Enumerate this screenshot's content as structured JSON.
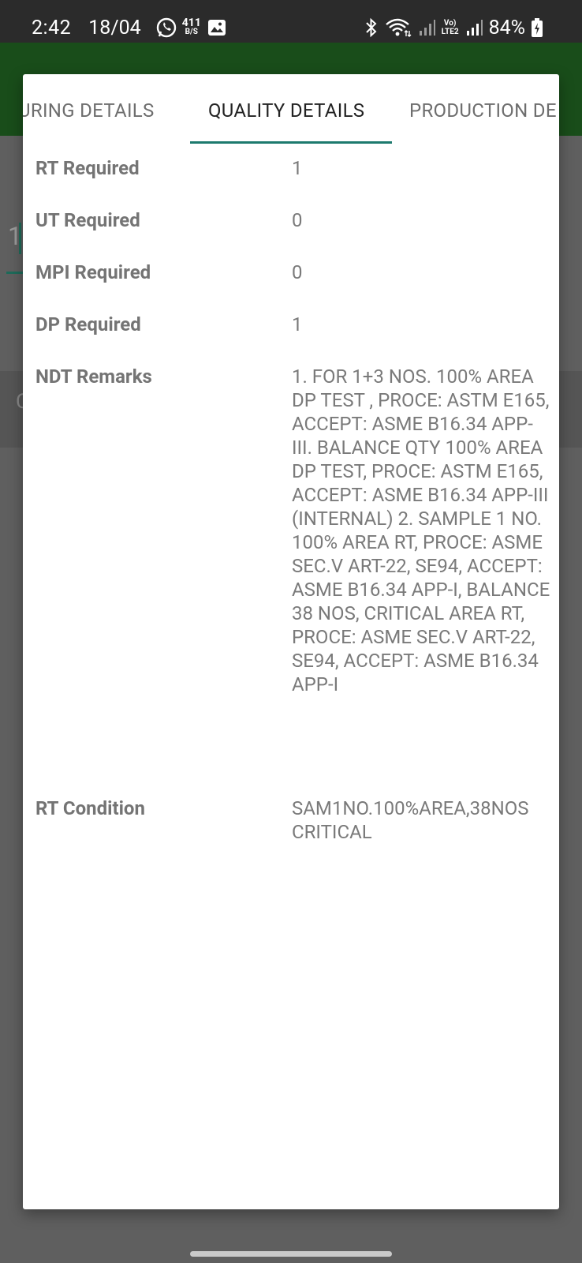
{
  "status_bar": {
    "time": "2:42",
    "date": "18/04",
    "net_speed_value": "411",
    "net_speed_unit": "B/S",
    "lte_top": "Vo)",
    "lte_bottom": "LTE2",
    "battery_percent": "84%"
  },
  "background": {
    "input_value": "1",
    "strip_char": "C"
  },
  "tabs": [
    {
      "label": "URING DETAILS",
      "active": false
    },
    {
      "label": "QUALITY DETAILS",
      "active": true
    },
    {
      "label": "PRODUCTION DE",
      "active": false
    }
  ],
  "quality_details": [
    {
      "label": "RT Required",
      "value": "1"
    },
    {
      "label": "UT Required",
      "value": "0"
    },
    {
      "label": "MPI Required",
      "value": "0"
    },
    {
      "label": "DP Required",
      "value": "1"
    },
    {
      "label": "NDT Remarks",
      "value": "1. FOR 1+3 NOS. 100% AREA DP TEST , PROCE: ASTM E165, ACCEPT: ASME B16.34 APP-III. BALANCE QTY 100% AREA DP TEST, PROCE: ASTM E165, ACCEPT: ASME B16.34 APP-III (INTERNAL) 2. SAMPLE 1 NO. 100% AREA RT, PROCE: ASME SEC.V ART-22, SE94, ACCEPT: ASME B16.34 APP-I, BALANCE 38 NOS, CRITICAL AREA RT, PROCE: ASME SEC.V ART-22, SE94, ACCEPT: ASME B16.34 APP-I"
    },
    {
      "label": "RT Condition",
      "value": "SAM1NO.100%AREA,38NOS CRITICAL"
    }
  ],
  "colors": {
    "app_bar": "#194d1a",
    "tab_indicator": "#1d7a6e",
    "status_bar": "#2b2b2b"
  }
}
